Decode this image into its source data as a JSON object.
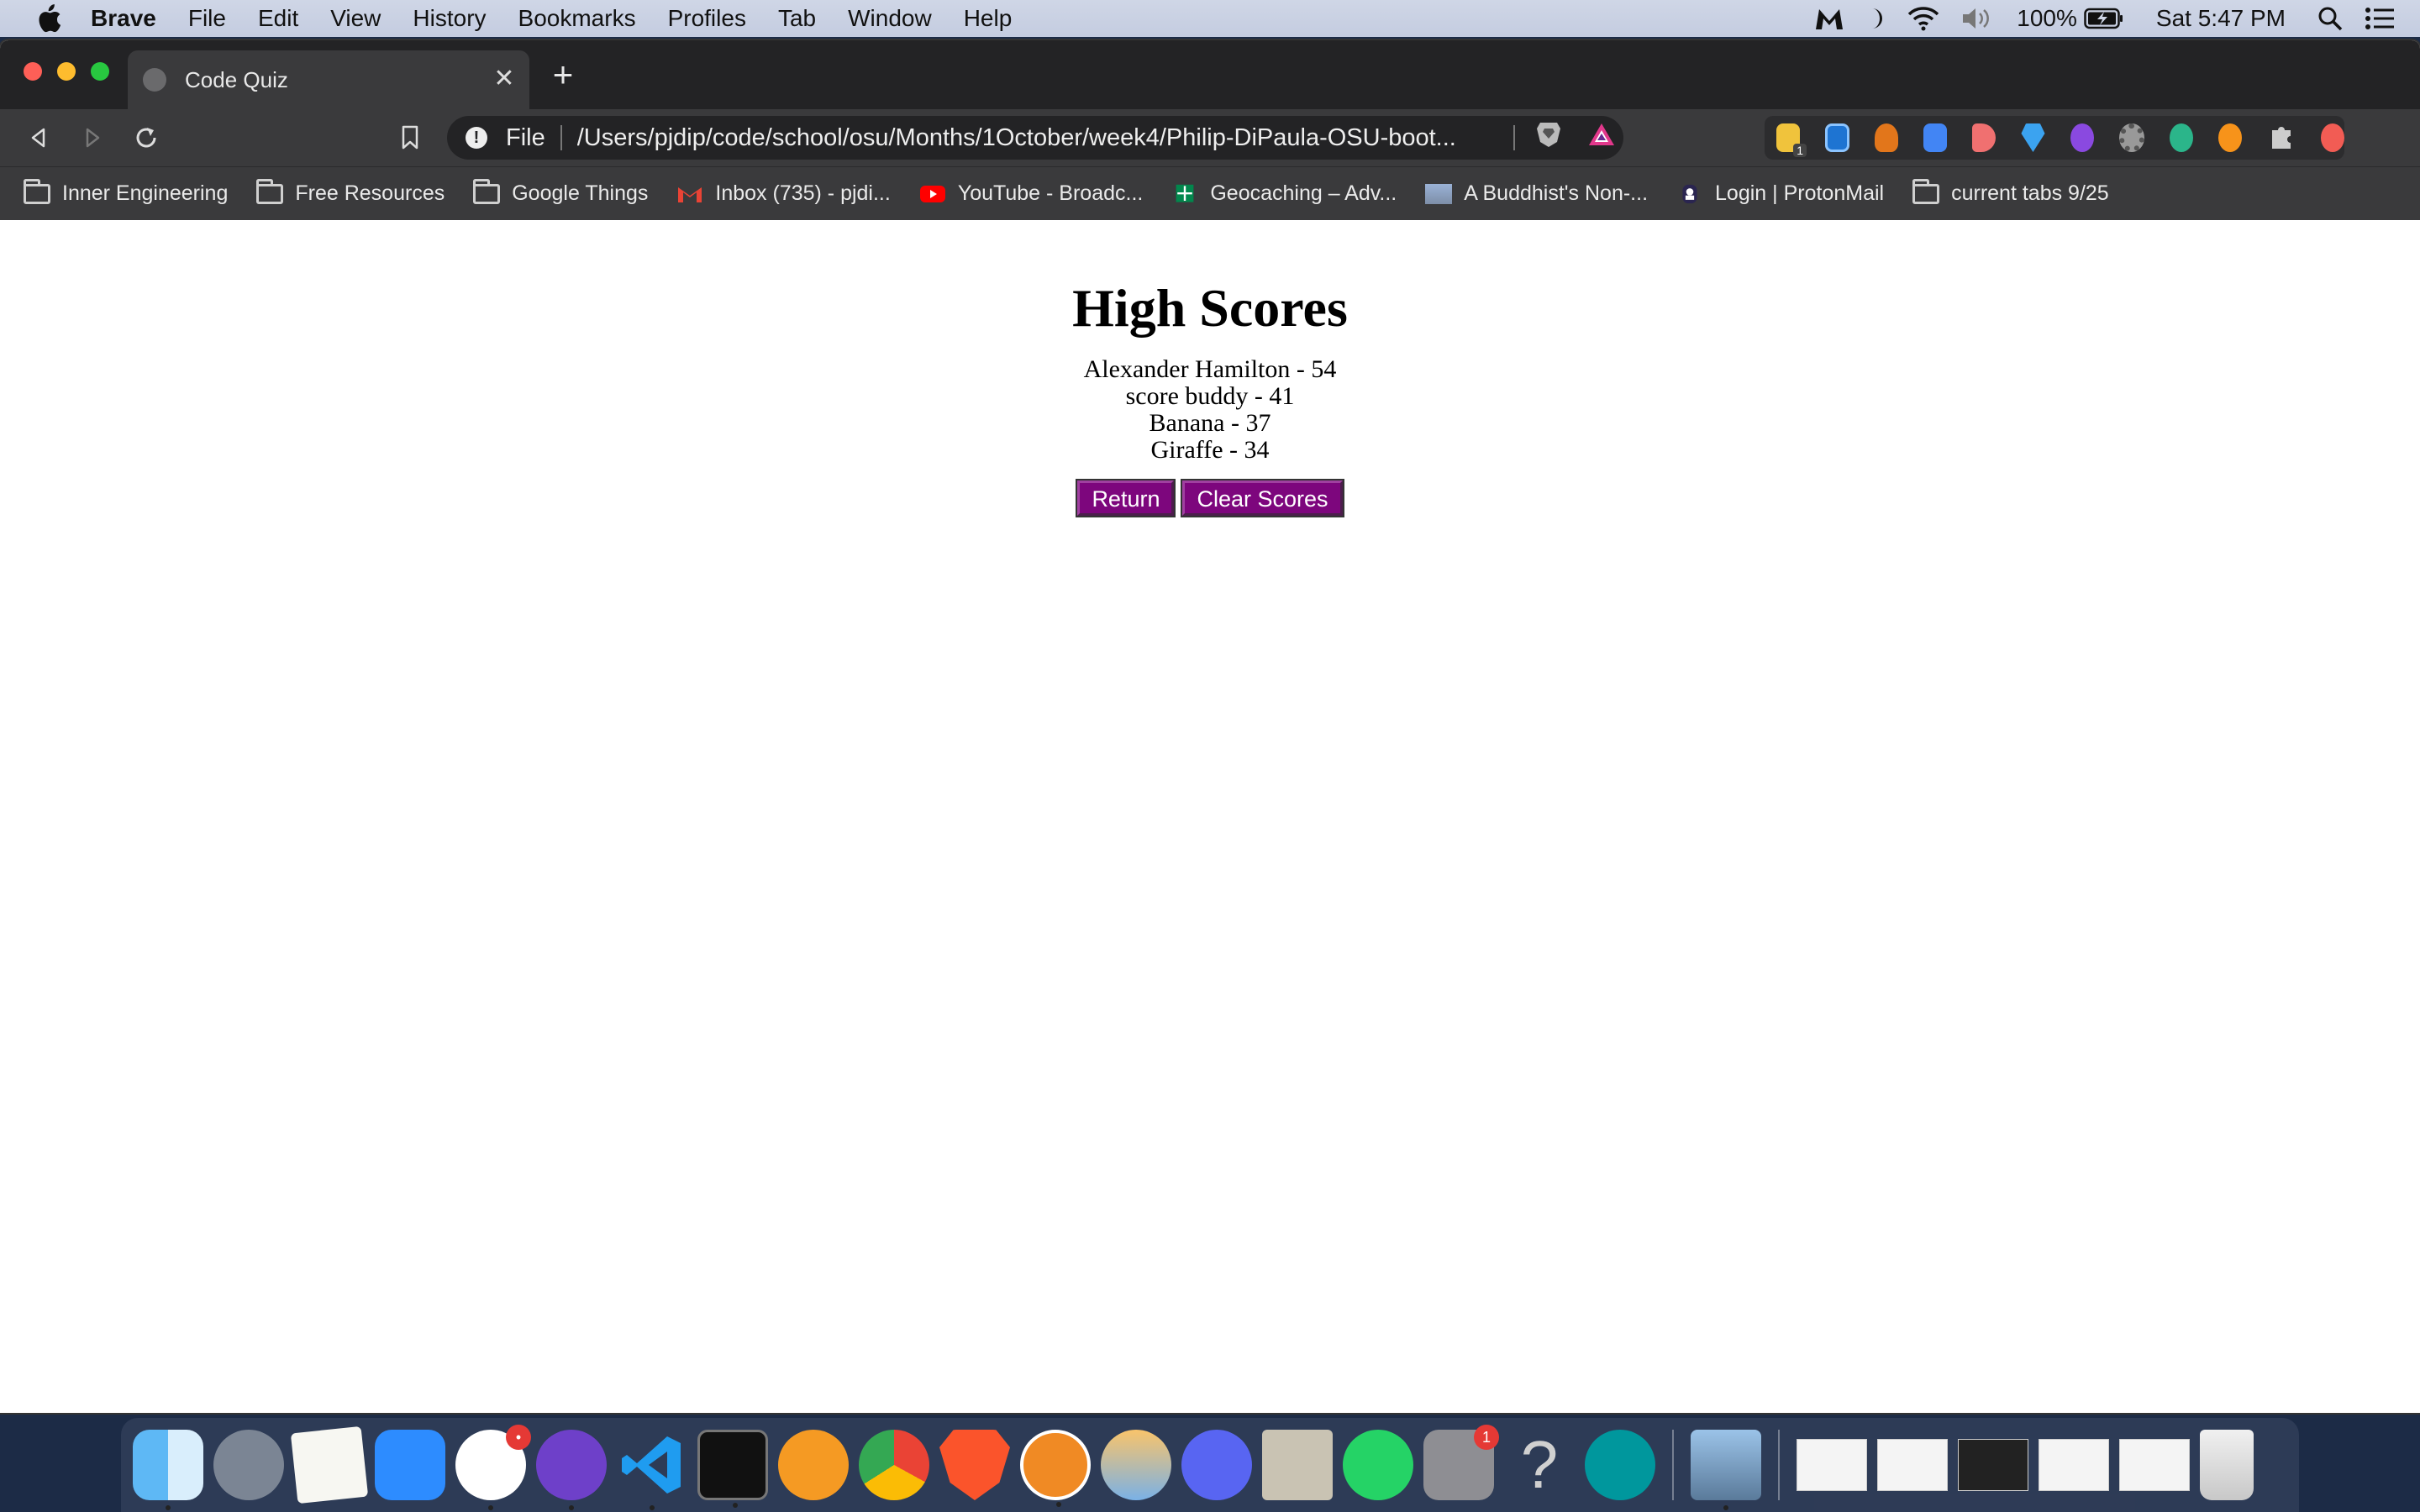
{
  "menubar": {
    "app_name": "Brave",
    "items": [
      "File",
      "Edit",
      "View",
      "History",
      "Bookmarks",
      "Profiles",
      "Tab",
      "Window",
      "Help"
    ],
    "battery": "100%",
    "clock": "Sat 5:47 PM"
  },
  "browser": {
    "tab_title": "Code Quiz",
    "url_scheme": "File",
    "url_path": "/Users/pjdip/code/school/osu/Months/1October/week4/Philip-DiPaula-OSU-boot...",
    "extension_badge": "1",
    "bookmarks": [
      {
        "label": "Inner Engineering",
        "icon": "folder-icon"
      },
      {
        "label": "Free Resources",
        "icon": "folder-icon"
      },
      {
        "label": "Google Things",
        "icon": "folder-icon"
      },
      {
        "label": "Inbox (735) - pjdi...",
        "icon": "gmail-icon"
      },
      {
        "label": "YouTube - Broadc...",
        "icon": "youtube-icon"
      },
      {
        "label": "Geocaching – Adv...",
        "icon": "geocaching-icon"
      },
      {
        "label": "A Buddhist's Non-...",
        "icon": "image-icon"
      },
      {
        "label": "Login | ProtonMail",
        "icon": "protonmail-icon"
      },
      {
        "label": "current tabs 9/25",
        "icon": "folder-icon"
      }
    ]
  },
  "page": {
    "title": "High Scores",
    "scores": [
      "Alexander Hamilton - 54",
      "score buddy - 41",
      "Banana - 37",
      "Giraffe - 34"
    ],
    "return_label": "Return",
    "clear_label": "Clear Scores"
  },
  "dock": {
    "badges": {
      "slack": "•",
      "settings": "1"
    }
  }
}
